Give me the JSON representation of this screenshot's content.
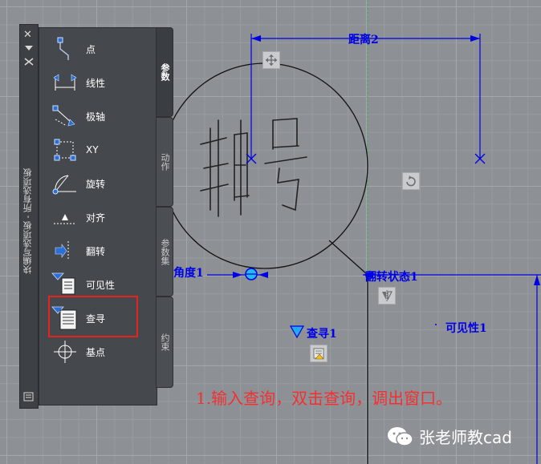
{
  "palette": {
    "title": "块编写选项板 - 所有选项板",
    "tabs": [
      "参数",
      "动作",
      "参数集",
      "约束"
    ],
    "items": [
      {
        "label": "点",
        "icon": "point-param-icon"
      },
      {
        "label": "线性",
        "icon": "linear-param-icon"
      },
      {
        "label": "极轴",
        "icon": "polar-param-icon"
      },
      {
        "label": "XY",
        "icon": "xy-param-icon"
      },
      {
        "label": "旋转",
        "icon": "rotation-param-icon"
      },
      {
        "label": "对齐",
        "icon": "alignment-param-icon"
      },
      {
        "label": "翻转",
        "icon": "flip-param-icon"
      },
      {
        "label": "可见性",
        "icon": "visibility-param-icon"
      },
      {
        "label": "查寻",
        "icon": "lookup-param-icon"
      },
      {
        "label": "基点",
        "icon": "basepoint-param-icon"
      }
    ],
    "close_glyph": "✕",
    "highlighted_item": "查寻"
  },
  "drawing": {
    "handwriting": "轴号",
    "labels": {
      "distance": "距离2",
      "angle": "角度1",
      "flip_state": "翻转状态1",
      "visibility": "可见性1",
      "lookup": "查寻1"
    },
    "colors": {
      "dimension": "#0000e6",
      "annotation": "#f23030",
      "highlight": "#e8231d",
      "geometry": "#111111"
    }
  },
  "instruction": "1.输入查询，双击查询，调出窗口。",
  "watermark": "张老师教cad"
}
